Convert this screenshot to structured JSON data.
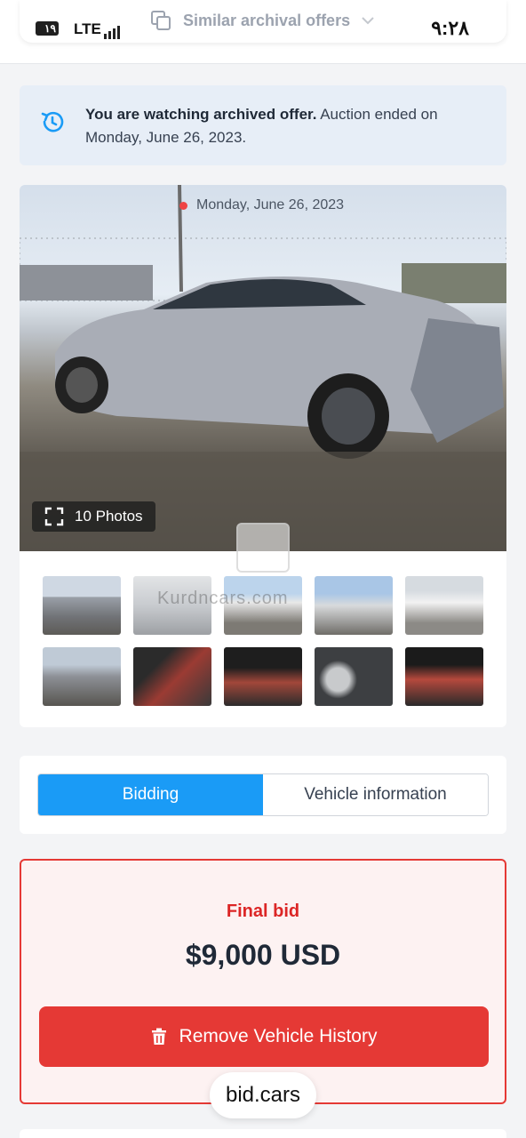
{
  "status_bar": {
    "sim_badge": "١٩",
    "network": "LTE",
    "time": "٩:٢٨"
  },
  "header": {
    "similar_label": "Similar archival offers"
  },
  "notice": {
    "bold_text": "You are watching archived offer.",
    "text": " Auction ended on Monday, June 26, 2023."
  },
  "gallery": {
    "date": "Monday, June 26, 2023",
    "photos_label": "10 Photos",
    "watermark": "Kurdncars.com",
    "thumbnail_count": 10
  },
  "tabs": [
    {
      "label": "Bidding",
      "active": true
    },
    {
      "label": "Vehicle information",
      "active": false
    }
  ],
  "bid": {
    "label": "Final bid",
    "amount": "$9,000 USD",
    "remove_button": "Remove Vehicle History"
  },
  "brand": {
    "name": "bid.cars"
  },
  "colors": {
    "accent_blue": "#1a9bf6",
    "danger_red": "#e53935",
    "notice_bg": "#e7eef7"
  }
}
